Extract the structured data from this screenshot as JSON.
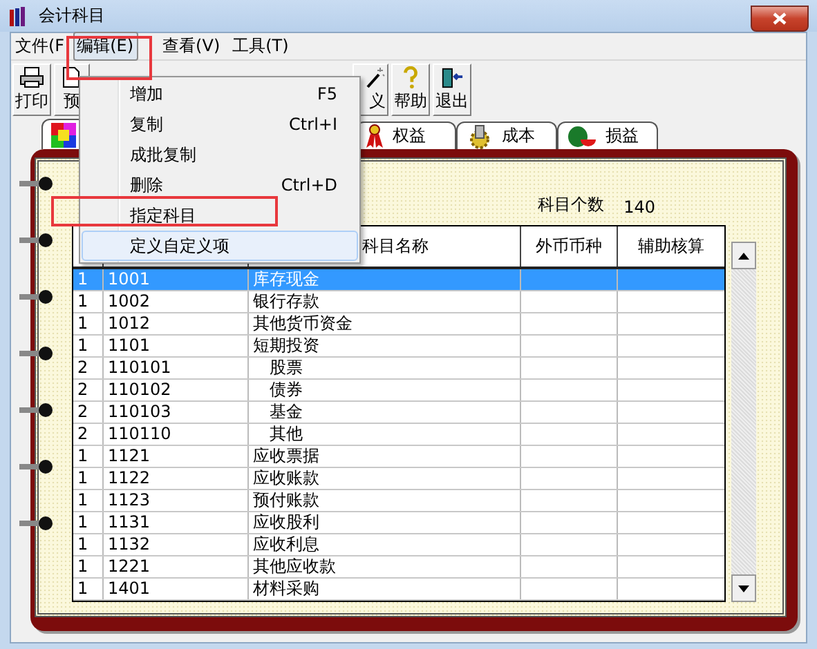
{
  "window": {
    "title": "会计科目"
  },
  "menu_bar": [
    {
      "label": "文件(F",
      "selected": false
    },
    {
      "label": "编辑(E)",
      "selected": true
    },
    {
      "label": "查看(V)",
      "selected": false
    },
    {
      "label": "工具(T)",
      "selected": false
    }
  ],
  "toolbar": [
    {
      "label": "打印"
    },
    {
      "label": "预"
    },
    {
      "label": "义"
    },
    {
      "label": "帮助"
    },
    {
      "label": "退出"
    }
  ],
  "tabs": [
    {
      "selected": true
    },
    {
      "label": "权益",
      "selected": false
    },
    {
      "label": "成本",
      "selected": false
    },
    {
      "label": "损益",
      "selected": false
    }
  ],
  "count": {
    "label": "科目个数",
    "value": "140"
  },
  "table": {
    "columns": [
      "科目名称",
      "外币币种",
      "辅助核算"
    ],
    "rows": [
      {
        "level": "1",
        "code": "1001",
        "name": "库存现金",
        "indented": false,
        "selected": true
      },
      {
        "level": "1",
        "code": "1002",
        "name": "银行存款",
        "indented": false,
        "selected": false
      },
      {
        "level": "1",
        "code": "1012",
        "name": "其他货币资金",
        "indented": false,
        "selected": false
      },
      {
        "level": "1",
        "code": "1101",
        "name": "短期投资",
        "indented": false,
        "selected": false
      },
      {
        "level": "2",
        "code": "110101",
        "name": "股票",
        "indented": true,
        "selected": false
      },
      {
        "level": "2",
        "code": "110102",
        "name": "债券",
        "indented": true,
        "selected": false
      },
      {
        "level": "2",
        "code": "110103",
        "name": "基金",
        "indented": true,
        "selected": false
      },
      {
        "level": "2",
        "code": "110110",
        "name": "其他",
        "indented": true,
        "selected": false
      },
      {
        "level": "1",
        "code": "1121",
        "name": "应收票据",
        "indented": false,
        "selected": false
      },
      {
        "level": "1",
        "code": "1122",
        "name": "应收账款",
        "indented": false,
        "selected": false
      },
      {
        "level": "1",
        "code": "1123",
        "name": "预付账款",
        "indented": false,
        "selected": false
      },
      {
        "level": "1",
        "code": "1131",
        "name": "应收股利",
        "indented": false,
        "selected": false
      },
      {
        "level": "1",
        "code": "1132",
        "name": "应收利息",
        "indented": false,
        "selected": false
      },
      {
        "level": "1",
        "code": "1221",
        "name": "其他应收款",
        "indented": false,
        "selected": false
      },
      {
        "level": "1",
        "code": "1401",
        "name": "材料采购",
        "indented": false,
        "selected": false
      }
    ]
  },
  "edit_menu": [
    {
      "label": "增加",
      "shortcut": "F5",
      "selected": false
    },
    {
      "label": "复制",
      "shortcut": "Ctrl+I",
      "selected": false
    },
    {
      "label": "成批复制",
      "selected": false
    },
    {
      "label": "删除",
      "shortcut": "Ctrl+D",
      "selected": false
    },
    {
      "label": "指定科目",
      "selected": false
    },
    {
      "label": "定义自定义项",
      "selected": true
    }
  ]
}
